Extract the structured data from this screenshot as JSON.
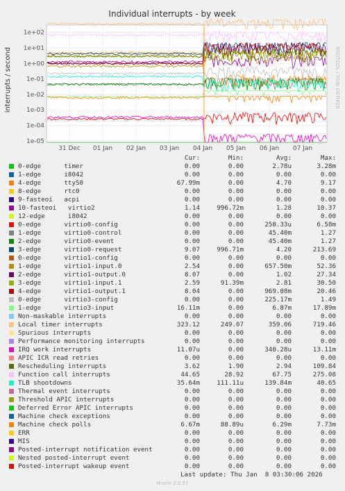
{
  "chart_data": {
    "type": "line",
    "title": "Individual interrupts - by week",
    "ylabel": "interrupts / second",
    "y_scale": "log",
    "ylim": [
      8e-06,
      300
    ],
    "y_ticks": [
      "1e-05",
      "1e-04",
      "1e-03",
      "1e-02",
      "1e-01",
      "1e+00",
      "1e+01",
      "1e+02"
    ],
    "x_ticks": [
      "31 Dec",
      "01 Jan",
      "02 Jan",
      "03 Jan",
      "04 Jan",
      "05 Jan",
      "06 Jan",
      "07 Jan"
    ],
    "side_label": "RRDTOOL / TOBI OETIKER",
    "grid": true,
    "legend_headers": {
      "cur": "Cur:",
      "min": "Min:",
      "avg": "Avg:",
      "max": "Max:"
    },
    "series": [
      {
        "name": "0-edge      timer",
        "color": "#00cc00",
        "cur": "0.00",
        "min": "0.00",
        "avg": "2.78u",
        "max": "3.28m"
      },
      {
        "name": "1-edge      i8042",
        "color": "#0066b3",
        "cur": "0.00",
        "min": "0.00",
        "avg": "0.00",
        "max": "0.00"
      },
      {
        "name": "4-edge      ttyS0",
        "color": "#ff8000",
        "cur": "67.99m",
        "min": "0.00",
        "avg": "4.70",
        "max": "9.17"
      },
      {
        "name": "8-edge      rtc0",
        "color": "#ffcc00",
        "cur": "0.00",
        "min": "0.00",
        "avg": "0.00",
        "max": "0.00"
      },
      {
        "name": "9-fasteoi   acpi",
        "color": "#330099",
        "cur": "0.00",
        "min": "0.00",
        "avg": "0.00",
        "max": "0.00"
      },
      {
        "name": "10-fasteoi   virtio2",
        "color": "#990099",
        "cur": "1.14",
        "min": "996.72m",
        "avg": "1.28",
        "max": "10.37"
      },
      {
        "name": "12-edge      i8042",
        "color": "#ccff00",
        "cur": "0.00",
        "min": "0.00",
        "avg": "0.00",
        "max": "0.00"
      },
      {
        "name": "0-edge      virtio0-config",
        "color": "#ff0000",
        "cur": "0.00",
        "min": "0.00",
        "avg": "258.33u",
        "max": "6.58m"
      },
      {
        "name": "1-edge      virtio0-control",
        "color": "#808080",
        "cur": "0.00",
        "min": "0.00",
        "avg": "45.40m",
        "max": "1.27"
      },
      {
        "name": "2-edge      virtio0-event",
        "color": "#008f00",
        "cur": "0.00",
        "min": "0.00",
        "avg": "45.40m",
        "max": "1.27"
      },
      {
        "name": "3-edge      virtio0-request",
        "color": "#00487d",
        "cur": "9.07",
        "min": "996.71m",
        "avg": "4.20",
        "max": "213.69"
      },
      {
        "name": "0-edge      virtio1-config",
        "color": "#b35a00",
        "cur": "0.00",
        "min": "0.00",
        "avg": "0.00",
        "max": "0.00"
      },
      {
        "name": "1-edge      virtio1-input.0",
        "color": "#b38f00",
        "cur": "2.54",
        "min": "0.00",
        "avg": "657.50m",
        "max": "52.36"
      },
      {
        "name": "2-edge      virtio1-output.0",
        "color": "#6b006b",
        "cur": "8.07",
        "min": "0.00",
        "avg": "1.02",
        "max": "27.34"
      },
      {
        "name": "3-edge      virtio1-input.1",
        "color": "#8fb300",
        "cur": "2.59",
        "min": "91.39m",
        "avg": "2.81",
        "max": "30.50"
      },
      {
        "name": "4-edge      virtio1-output.1",
        "color": "#b30000",
        "cur": "8.04",
        "min": "0.00",
        "avg": "969.08m",
        "max": "20.46"
      },
      {
        "name": "0-edge      virtio3-config",
        "color": "#bebebe",
        "cur": "0.00",
        "min": "0.00",
        "avg": "225.17m",
        "max": "1.49"
      },
      {
        "name": "1-edge      virtio3-input",
        "color": "#80ff80",
        "cur": "16.11m",
        "min": "0.00",
        "avg": "6.87m",
        "max": "17.89m"
      },
      {
        "name": "Non-maskable interrupts",
        "color": "#80c9ff",
        "cur": "0.00",
        "min": "0.00",
        "avg": "0.00",
        "max": "0.00"
      },
      {
        "name": "Local timer interrupts",
        "color": "#ffc080",
        "cur": "323.12",
        "min": "249.07",
        "avg": "359.06",
        "max": "719.46"
      },
      {
        "name": "Spurious interrupts",
        "color": "#ffe680",
        "cur": "0.00",
        "min": "0.00",
        "avg": "0.00",
        "max": "0.00"
      },
      {
        "name": "Performance monitoring interrupts",
        "color": "#aa80ff",
        "cur": "0.00",
        "min": "0.00",
        "avg": "0.00",
        "max": "0.00"
      },
      {
        "name": "IRQ work interrupts",
        "color": "#ee00cc",
        "cur": "11.07u",
        "min": "0.00",
        "avg": "340.28u",
        "max": "13.11m"
      },
      {
        "name": "APIC ICR read retries",
        "color": "#ff8080",
        "cur": "0.00",
        "min": "0.00",
        "avg": "0.00",
        "max": "0.00"
      },
      {
        "name": "Rescheduling interrupts",
        "color": "#666600",
        "cur": "3.62",
        "min": "1.90",
        "avg": "2.94",
        "max": "109.84"
      },
      {
        "name": "Function call interrupts",
        "color": "#ffbfff",
        "cur": "44.65",
        "min": "28.92",
        "avg": "67.75",
        "max": "275.08"
      },
      {
        "name": "TLB shootdowns",
        "color": "#00ffcc",
        "cur": "35.64m",
        "min": "111.11u",
        "avg": "139.84m",
        "max": "40.65"
      },
      {
        "name": "Thermal event interrupts",
        "color": "#cc6699",
        "cur": "0.00",
        "min": "0.00",
        "avg": "0.00",
        "max": "0.00"
      },
      {
        "name": "Threshold APIC interrupts",
        "color": "#999900",
        "cur": "0.00",
        "min": "0.00",
        "avg": "0.00",
        "max": "0.00"
      },
      {
        "name": "Deferred Error APIC interrupts",
        "color": "#00cc00",
        "cur": "0.00",
        "min": "0.00",
        "avg": "0.00",
        "max": "0.00"
      },
      {
        "name": "Machine check exceptions",
        "color": "#0066b3",
        "cur": "0.00",
        "min": "0.00",
        "avg": "0.00",
        "max": "0.00"
      },
      {
        "name": "Machine check polls",
        "color": "#ff8000",
        "cur": "6.67m",
        "min": "88.89u",
        "avg": "6.29m",
        "max": "7.73m"
      },
      {
        "name": "ERR",
        "color": "#ffcc00",
        "cur": "0.00",
        "min": "0.00",
        "avg": "0.00",
        "max": "0.00"
      },
      {
        "name": "MIS",
        "color": "#330099",
        "cur": "0.00",
        "min": "0.00",
        "avg": "0.00",
        "max": "0.00"
      },
      {
        "name": "Posted-interrupt notification event",
        "color": "#990099",
        "cur": "0.00",
        "min": "0.00",
        "avg": "0.00",
        "max": "0.00"
      },
      {
        "name": "Nested posted-interrupt event",
        "color": "#ccff00",
        "cur": "0.00",
        "min": "0.00",
        "avg": "0.00",
        "max": "0.00"
      },
      {
        "name": "Posted-interrupt wakeup event",
        "color": "#ff0000",
        "cur": "0.00",
        "min": "0.00",
        "avg": "0.00",
        "max": "0.00"
      }
    ],
    "last_update": "Last update: Thu Jan  8 03:30:06 2026",
    "footer": "Munin 2.0.57"
  }
}
